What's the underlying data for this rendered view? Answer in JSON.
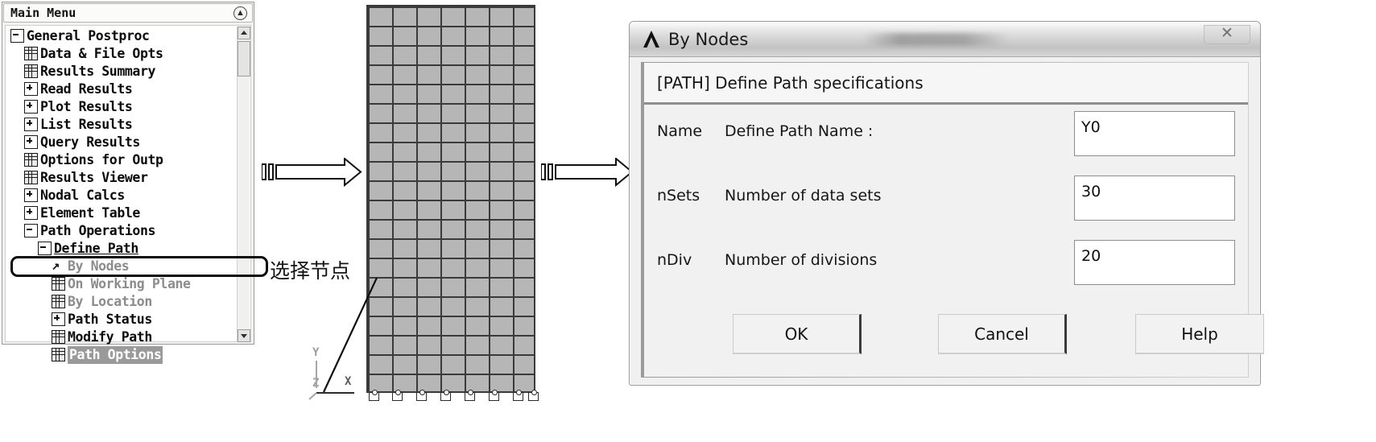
{
  "main_menu": {
    "title": "Main Menu",
    "collapse_icon": "collapse-chevrons-icon",
    "tree": [
      {
        "label": "General Postproc",
        "indent": 0,
        "glyph": "minus",
        "style": "normal"
      },
      {
        "label": "Data & File Opts",
        "indent": 1,
        "glyph": "doc",
        "style": "normal"
      },
      {
        "label": "Results Summary",
        "indent": 1,
        "glyph": "doc",
        "style": "normal"
      },
      {
        "label": "Read Results",
        "indent": 1,
        "glyph": "plus",
        "style": "normal"
      },
      {
        "label": "Plot Results",
        "indent": 1,
        "glyph": "plus",
        "style": "normal"
      },
      {
        "label": "List Results",
        "indent": 1,
        "glyph": "plus",
        "style": "normal"
      },
      {
        "label": "Query Results",
        "indent": 1,
        "glyph": "plus",
        "style": "normal"
      },
      {
        "label": "Options for Outp",
        "indent": 1,
        "glyph": "doc",
        "style": "normal"
      },
      {
        "label": "Results Viewer",
        "indent": 1,
        "glyph": "doc",
        "style": "normal"
      },
      {
        "label": "Nodal Calcs",
        "indent": 1,
        "glyph": "plus",
        "style": "normal"
      },
      {
        "label": "Element Table",
        "indent": 1,
        "glyph": "plus",
        "style": "normal"
      },
      {
        "label": "Path Operations",
        "indent": 1,
        "glyph": "minus",
        "style": "normal"
      },
      {
        "label": "Define Path",
        "indent": 2,
        "glyph": "minus",
        "style": "underline"
      },
      {
        "label": "By Nodes",
        "indent": 3,
        "glyph": "arrow",
        "style": "gray"
      },
      {
        "label": "On Working Plane",
        "indent": 3,
        "glyph": "doc",
        "style": "gray"
      },
      {
        "label": "By Location",
        "indent": 3,
        "glyph": "doc",
        "style": "gray"
      },
      {
        "label": "Path Status",
        "indent": 3,
        "glyph": "plus",
        "style": "normal"
      },
      {
        "label": "Modify Path",
        "indent": 3,
        "glyph": "doc",
        "style": "normal"
      },
      {
        "label": "Path Options",
        "indent": 3,
        "glyph": "doc",
        "style": "selected"
      }
    ],
    "highlighted_item": "By Nodes",
    "scrollbar": {
      "up_arrow_icon": "scroll-up-arrow-icon",
      "down_arrow_icon": "scroll-down-arrow-icon"
    }
  },
  "flow": {
    "arrow_1": "right-arrow-icon",
    "arrow_2": "right-arrow-icon"
  },
  "model": {
    "annotation": "选择节点",
    "leader_line": "leader-line",
    "axis_triad": {
      "x": "X",
      "y": "Y",
      "z": "Z"
    },
    "mesh": {
      "columns": 7,
      "rows": 20,
      "constraint_symbols": 8
    }
  },
  "dialog": {
    "title": "By Nodes",
    "logo_icon": "ansys-logo-icon",
    "close_label": "✕",
    "header": "[PATH]  Define Path specifications",
    "fields": [
      {
        "key": "Name",
        "label": "Define Path Name :",
        "value": "Y0"
      },
      {
        "key": "nSets",
        "label": "Number of data sets",
        "value": "30"
      },
      {
        "key": "nDiv",
        "label": "Number of divisions",
        "value": "20"
      }
    ],
    "buttons": {
      "ok": "OK",
      "cancel": "Cancel",
      "help": "Help"
    }
  },
  "colors": {
    "mesh_fill": "#b6b6b6",
    "mesh_line": "#3a3a3a",
    "selection": "#9a9a9a",
    "dialog_bg": "#f0f0f0"
  }
}
